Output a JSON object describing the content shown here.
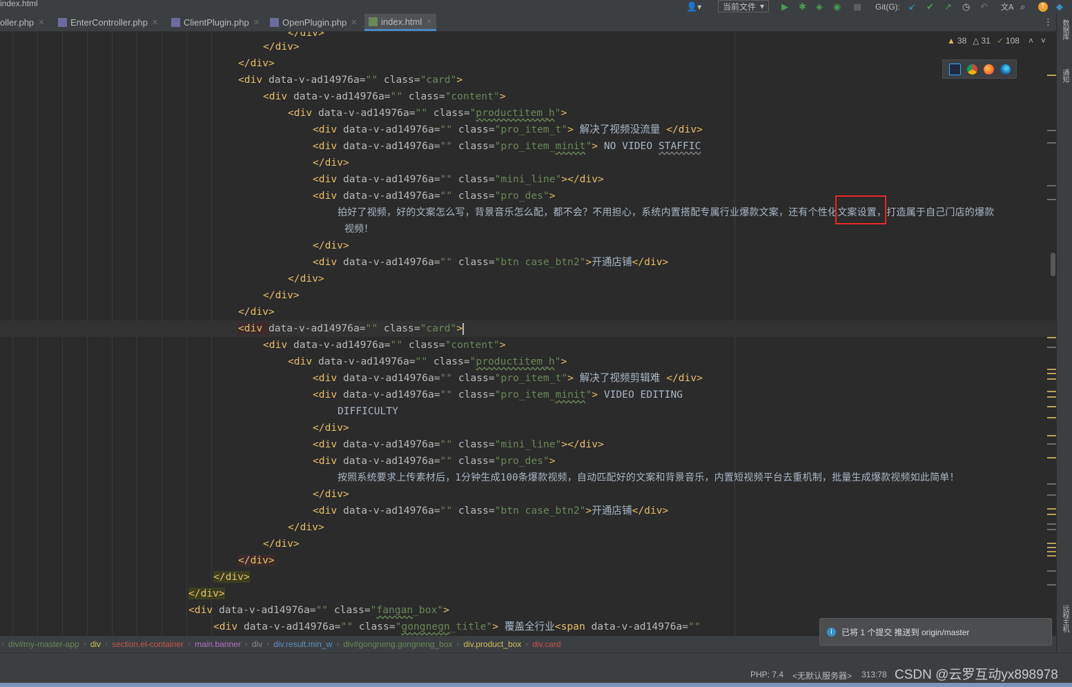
{
  "window": {
    "title_fragment": "index.html"
  },
  "toolbar": {
    "run_config": "当前文件",
    "git_label": "Git(G):"
  },
  "tabs": [
    {
      "label": "oller.php"
    },
    {
      "label": "EnterController.php"
    },
    {
      "label": "ClientPlugin.php"
    },
    {
      "label": "OpenPlugin.php"
    },
    {
      "label": "index.html"
    }
  ],
  "inspections": {
    "warnings": "38",
    "weak_warnings": "31",
    "typos": "108"
  },
  "code": {
    "l0": "</div>",
    "l1": "</div>",
    "l2": "</div>",
    "l3a": "<div ",
    "l3b": "data-v-ad14976a=",
    "l3c": "\"\"",
    "l3d": " class=",
    "l3e": "\"card\"",
    "l3f": ">",
    "l4a": "<div ",
    "l4b": "data-v-ad14976a=",
    "l4c": "\"\"",
    "l4d": " class=",
    "l4e": "\"content\"",
    "l4f": ">",
    "l5a": "<div ",
    "l5b": "data-v-ad14976a=",
    "l5c": "\"\"",
    "l5d": " class=",
    "l5e1": "\"",
    "l5e2": "productitem_h",
    "l5e3": "\"",
    "l5f": ">",
    "l6a": "<div ",
    "l6b": "data-v-ad14976a=",
    "l6c": "\"\"",
    "l6d": " class=",
    "l6e": "\"pro_item_t\"",
    "l6f": ">",
    "l6g": " 解决了视频没流量 ",
    "l6h": "</div>",
    "l7a": "<div ",
    "l7b": "data-v-ad14976a=",
    "l7c": "\"\"",
    "l7d": " class=",
    "l7e1": "\"pro_item_",
    "l7e2": "minit",
    "l7e3": "\"",
    "l7f": ">",
    "l7g": " NO VIDEO ",
    "l7h": "STAFFIC",
    "l8": "</div>",
    "l9a": "<div ",
    "l9b": "data-v-ad14976a=",
    "l9c": "\"\"",
    "l9d": " class=",
    "l9e": "\"mini_line\"",
    "l9f": "></div>",
    "l10a": "<div ",
    "l10b": "data-v-ad14976a=",
    "l10c": "\"\"",
    "l10d": " class=",
    "l10e": "\"pro_des\"",
    "l10f": ">",
    "l11": "拍好了视频，好的文案怎么写，背景音乐怎么配，都不会？不用担心，系统内置搭配专属行业爆款文案，还有个性化文案设置，打造属于自己门店的爆款",
    "l12": "视频！",
    "l13": "</div>",
    "l14a": "<div ",
    "l14b": "data-v-ad14976a=",
    "l14c": "\"\"",
    "l14d": " class=",
    "l14e": "\"btn case_btn2\"",
    "l14f": ">",
    "l14g": "开通店铺",
    "l14h": "</div>",
    "l15": "</div>",
    "l16": "</div>",
    "l17": "</div>",
    "l18a": "<div ",
    "l18b": "data-v-ad14976a=",
    "l18c": "\"\"",
    "l18d": " class=",
    "l18e": "\"card\"",
    "l18f": ">",
    "l19a": "<div ",
    "l19b": "data-v-ad14976a=",
    "l19c": "\"\"",
    "l19d": " class=",
    "l19e": "\"content\"",
    "l19f": ">",
    "l20a": "<div ",
    "l20b": "data-v-ad14976a=",
    "l20c": "\"\"",
    "l20d": " class=",
    "l20e1": "\"",
    "l20e2": "productitem_h",
    "l20e3": "\"",
    "l20f": ">",
    "l21a": "<div ",
    "l21b": "data-v-ad14976a=",
    "l21c": "\"\"",
    "l21d": " class=",
    "l21e": "\"pro_item_t\"",
    "l21f": ">",
    "l21g": " 解决了视频剪辑难 ",
    "l21h": "</div>",
    "l22a": "<div ",
    "l22b": "data-v-ad14976a=",
    "l22c": "\"\"",
    "l22d": " class=",
    "l22e1": "\"pro_item_",
    "l22e2": "minit",
    "l22e3": "\"",
    "l22f": ">",
    "l22g": " VIDEO EDITING",
    "l23": "DIFFICULTY",
    "l24": "</div>",
    "l25a": "<div ",
    "l25b": "data-v-ad14976a=",
    "l25c": "\"\"",
    "l25d": " class=",
    "l25e": "\"mini_line\"",
    "l25f": "></div>",
    "l26a": "<div ",
    "l26b": "data-v-ad14976a=",
    "l26c": "\"\"",
    "l26d": " class=",
    "l26e": "\"pro_des\"",
    "l26f": ">",
    "l27": "按照系统要求上传素材后，1分钟生成100条爆款视频，自动匹配好的文案和背景音乐，内置短视频平台去重机制，批量生成爆款视频如此简单！",
    "l28": "</div>",
    "l29a": "<div ",
    "l29b": "data-v-ad14976a=",
    "l29c": "\"\"",
    "l29d": " class=",
    "l29e": "\"btn case_btn2\"",
    "l29f": ">",
    "l29g": "开通店铺",
    "l29h": "</div>",
    "l30": "</div>",
    "l31": "</div>",
    "l32": "</div>",
    "l33": "</div>",
    "l34": "</div>",
    "l35a": "<div ",
    "l35b": "data-v-ad14976a=",
    "l35c": "\"\"",
    "l35d": " class=",
    "l35e1": "\"",
    "l35e2": "fangan",
    "l35e3": "_box\"",
    "l35f": ">",
    "l36a": "<div ",
    "l36b": "data-v-ad14976a=",
    "l36c": "\"\"",
    "l36d": " class=",
    "l36e1": "\"",
    "l36e2": "gongnegn",
    "l36e3": "_title\"",
    "l36f": ">",
    "l36g": " 覆盖全行业",
    "l36h": "<span ",
    "l36i": "data-v-ad14976a=",
    "l36j": "\"\""
  },
  "breadcrumb": [
    {
      "label": "div#my-master-app",
      "color": "#6a8759"
    },
    {
      "label": "div",
      "color": "#cfbf5a"
    },
    {
      "label": "section.el-container",
      "color": "#c75450"
    },
    {
      "label": "main.banner",
      "color": "#b074c4"
    },
    {
      "label": "div",
      "color": "#8a8a8a"
    },
    {
      "label": "div.result.min_w",
      "color": "#5f8fc7"
    },
    {
      "label": "div#gongneng.gongneng_box",
      "color": "#6a8759"
    },
    {
      "label": "div.product_box",
      "color": "#cfbf5a"
    },
    {
      "label": "div.card",
      "color": "#c75450"
    }
  ],
  "notification": {
    "text": "已将 1 个提交 推送到 origin/master"
  },
  "status": {
    "php": "PHP: 7.4",
    "server": "<无默认服务器>",
    "position": "313:78"
  },
  "watermark": "CSDN @云罗互动yx898978",
  "sidebar": {
    "db_label": "数据库",
    "notify_label": "通知",
    "remote_label": "远程主机"
  }
}
